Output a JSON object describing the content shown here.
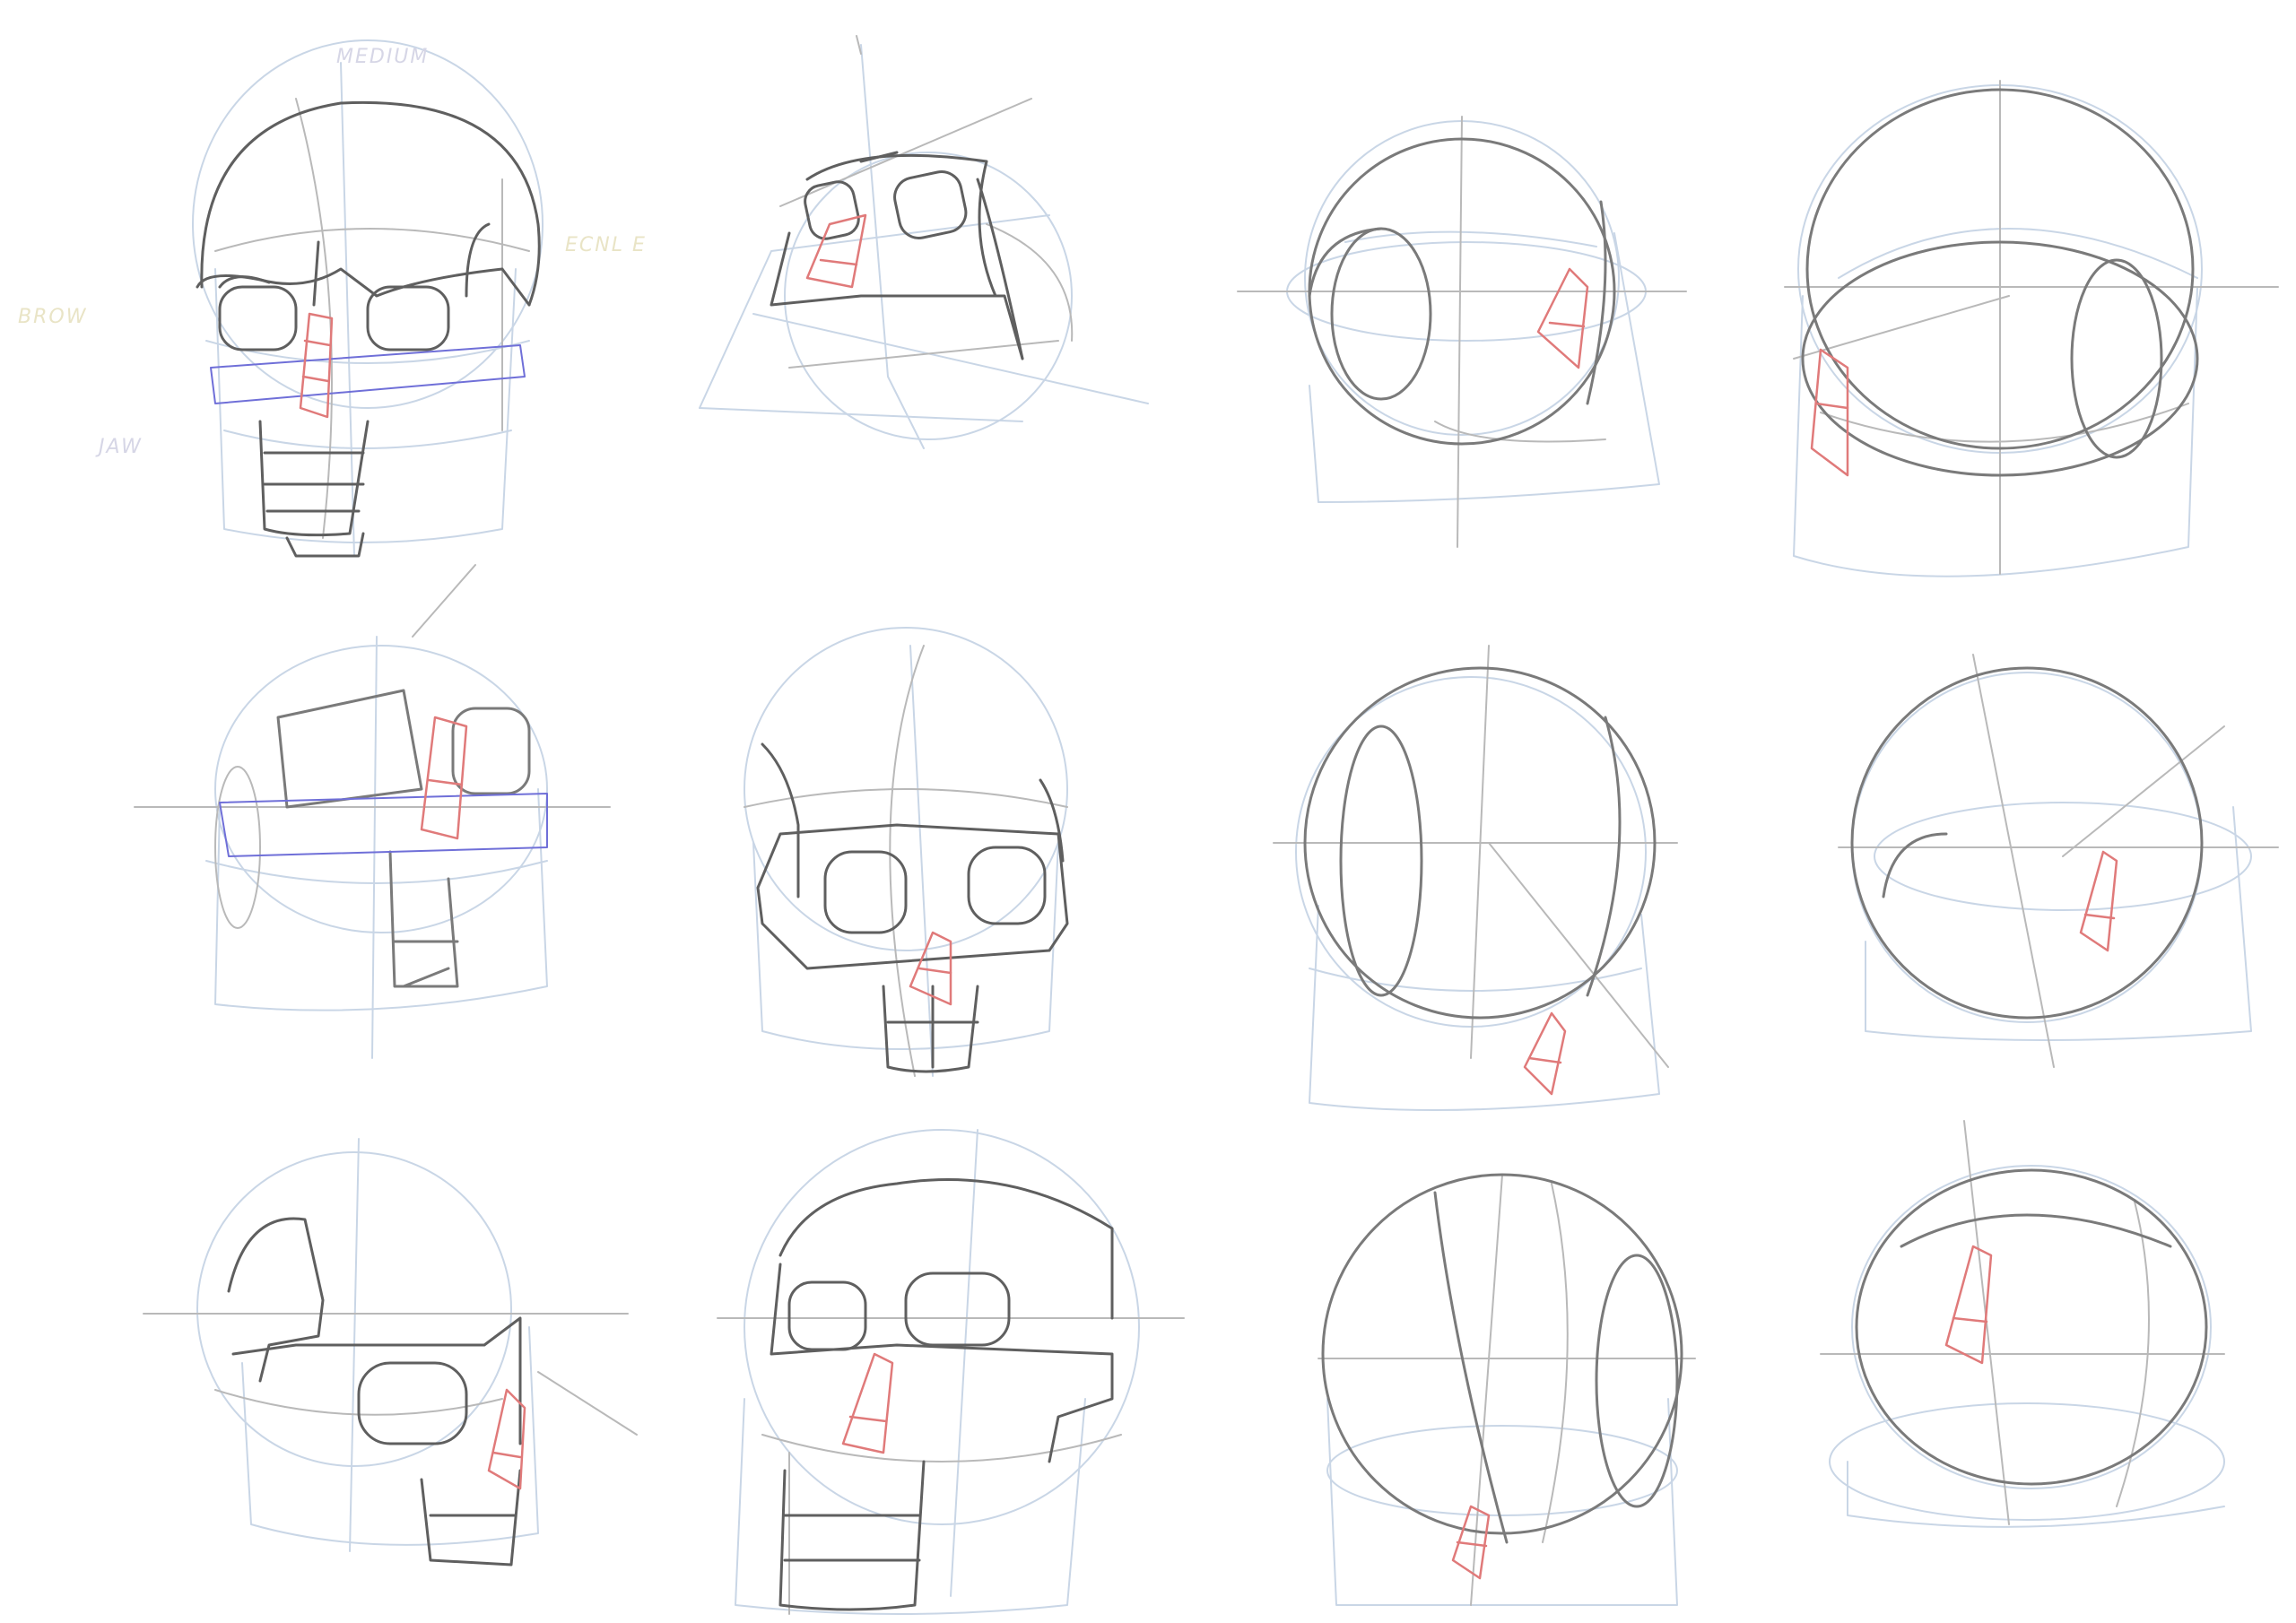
{
  "image": {
    "kind": "pencil sketch sheet",
    "subject": "skull / head construction studies (Loomis-style spheres, skull planes, nose wedges)",
    "layout": "3 rows x 4 columns"
  },
  "colors": {
    "paper": "#ffffff",
    "graphite": "#5f5f5f",
    "graphite_light": "#b9b9b9",
    "construction_blue": "#c9d6e6",
    "blue_pencil": "#6f6fd8",
    "red_pencil": "#e07a7a",
    "faint_yellow": "#e9e4c6"
  },
  "annotations": {
    "top_label": "MEDIUM",
    "right_label": "ECNL E",
    "left_label": "BROW",
    "jaw_label": "JAW"
  },
  "studies": [
    {
      "name": "skull-front-3q-row1",
      "style": "skull"
    },
    {
      "name": "skull-tilted-row1",
      "style": "skull"
    },
    {
      "name": "head-sphere-row1-a",
      "style": "sphere"
    },
    {
      "name": "head-sphere-row1-b",
      "style": "sphere"
    },
    {
      "name": "skull-band-row2",
      "style": "skull"
    },
    {
      "name": "skull-front-row2",
      "style": "skull"
    },
    {
      "name": "head-sphere-row2-a",
      "style": "sphere"
    },
    {
      "name": "head-sphere-row2-b",
      "style": "sphere"
    },
    {
      "name": "skull-profile-row3",
      "style": "skull"
    },
    {
      "name": "skull-3q-row3",
      "style": "skull"
    },
    {
      "name": "head-sphere-row3-a",
      "style": "sphere"
    },
    {
      "name": "head-sphere-row3-b",
      "style": "sphere"
    }
  ]
}
